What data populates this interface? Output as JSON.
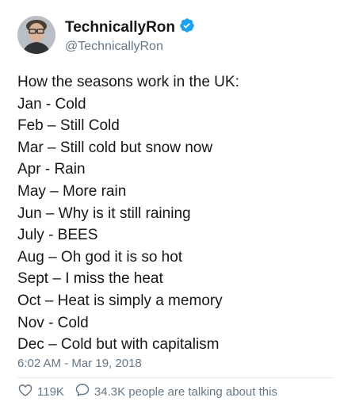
{
  "user": {
    "display_name": "TechnicallyRon",
    "handle": "@TechnicallyRon",
    "verified_icon": "verified-badge-icon",
    "avatar": "avatar"
  },
  "tweet": {
    "lines": [
      "How the seasons work in the UK:",
      "Jan - Cold",
      "Feb – Still Cold",
      "Mar – Still cold but snow now",
      "Apr - Rain",
      "May – More rain",
      "Jun – Why is it still raining",
      "July - BEES",
      "Aug – Oh god it is so hot",
      "Sept – I miss the heat",
      "Oct – Heat is simply a memory",
      "Nov - Cold",
      "Dec – Cold but with capitalism"
    ],
    "timestamp": "6:02 AM - Mar 19, 2018"
  },
  "actions": {
    "like_count": "119K",
    "reply_text": "34.3K people are talking about this",
    "like_icon": "heart-icon",
    "reply_icon": "speech-bubble-icon"
  },
  "colors": {
    "accent": "#1da1f2",
    "text": "#14171a",
    "secondary": "#657786"
  }
}
